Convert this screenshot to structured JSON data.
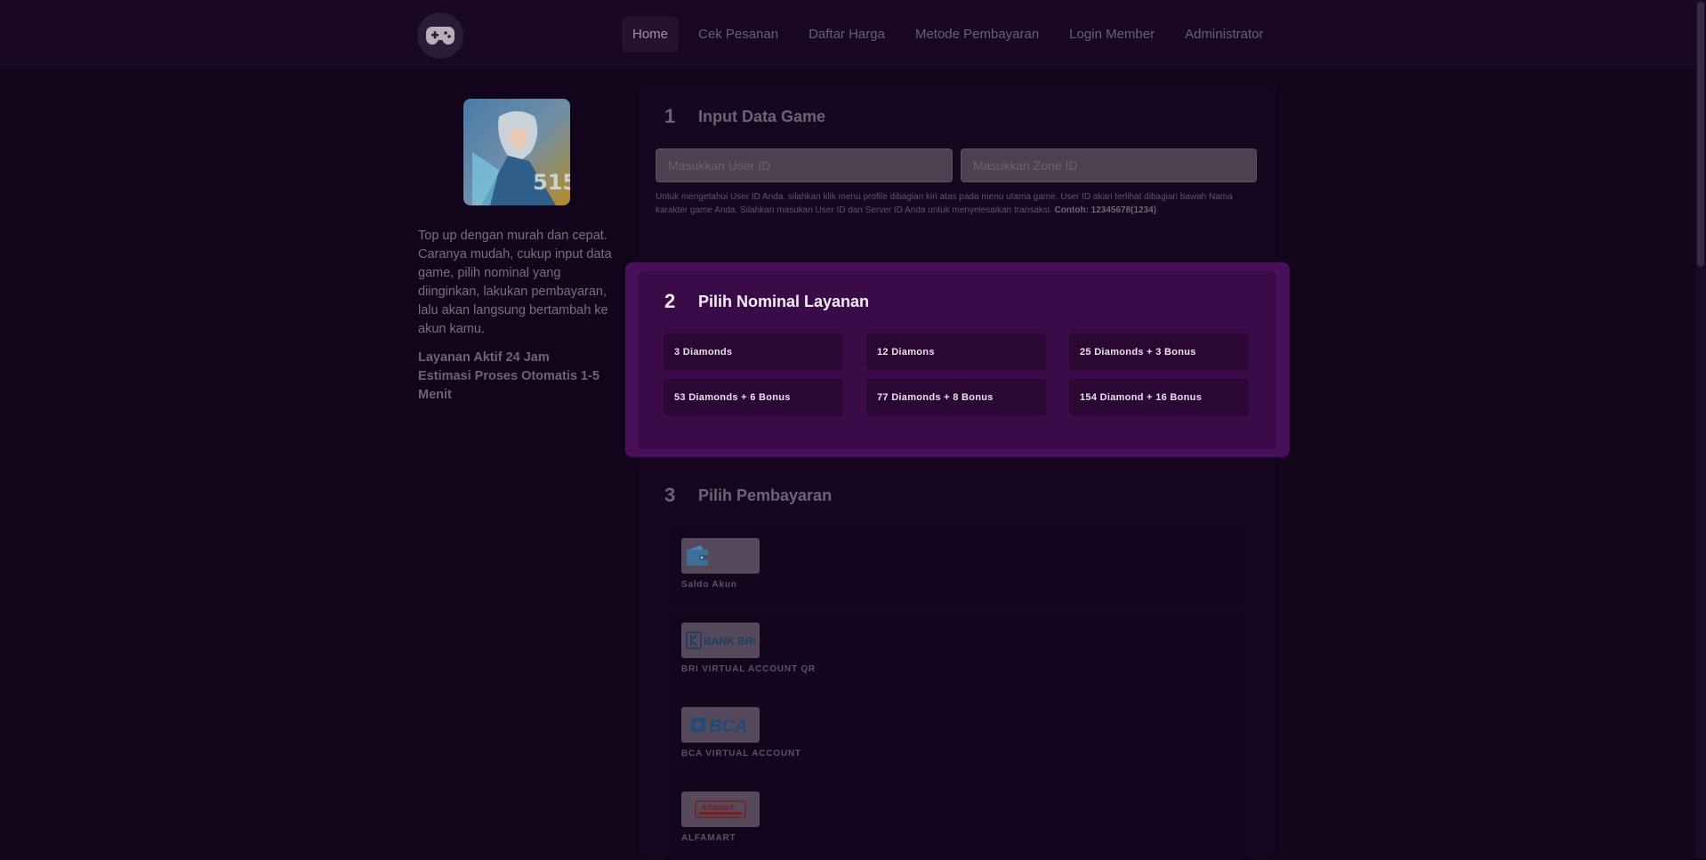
{
  "nav": {
    "items": [
      {
        "label": "Home",
        "active": true
      },
      {
        "label": "Cek Pesanan",
        "active": false
      },
      {
        "label": "Daftar Harga",
        "active": false
      },
      {
        "label": "Metode Pembayaran",
        "active": false
      },
      {
        "label": "Login Member",
        "active": false
      },
      {
        "label": "Administrator",
        "active": false
      }
    ]
  },
  "game": {
    "cover_icon": "game-character-image",
    "description": "Top up dengan murah dan cepat. Caranya mudah, cukup input data game, pilih nominal yang diinginkan, lakukan pembayaran, lalu akan langsung bertambah ke akun kamu.",
    "info_line1": "Layanan Aktif 24 Jam",
    "info_line2": "Estimasi Proses Otomatis 1-5 Menit"
  },
  "section1": {
    "number": "1",
    "title": "Input Data Game",
    "user_id_placeholder": "Masukkan User ID",
    "zone_id_placeholder": "Masukkan Zone ID",
    "hint": "Untuk mengetahui User ID Anda, silahkan klik menu profile dibagian kiri atas pada menu utama game. User ID akan terlihat dibagian bawah Nama karakter game Anda. Silahkan masukan User ID dan Server ID Anda untuk menyelesaikan transaksi.",
    "hint_example": "Contoh: 12345678(1234)",
    "hint_end": "."
  },
  "section2": {
    "number": "2",
    "title": "Pilih Nominal Layanan",
    "nominals": [
      "3 Diamonds",
      "12 Diamons",
      "25 Diamonds + 3 Bonus",
      "53 Diamonds + 6 Bonus",
      "77 Diamonds + 8 Bonus",
      "154 Diamond + 16 Bonus"
    ]
  },
  "section3": {
    "number": "3",
    "title": "Pilih Pembayaran",
    "payments": [
      {
        "label": "Saldo Akun",
        "logo": "wallet-icon"
      },
      {
        "label": "BRI VIRTUAL ACCOUNT QR",
        "logo": "BANK BRI"
      },
      {
        "label": "BCA VIRTUAL ACCOUNT",
        "logo": "BCA"
      },
      {
        "label": "ALFAMART",
        "logo": "Alfamart"
      }
    ]
  },
  "colors": {
    "background": "#12041a",
    "accent": "#4a0f5a",
    "nominal_bg": "#2b0734"
  }
}
